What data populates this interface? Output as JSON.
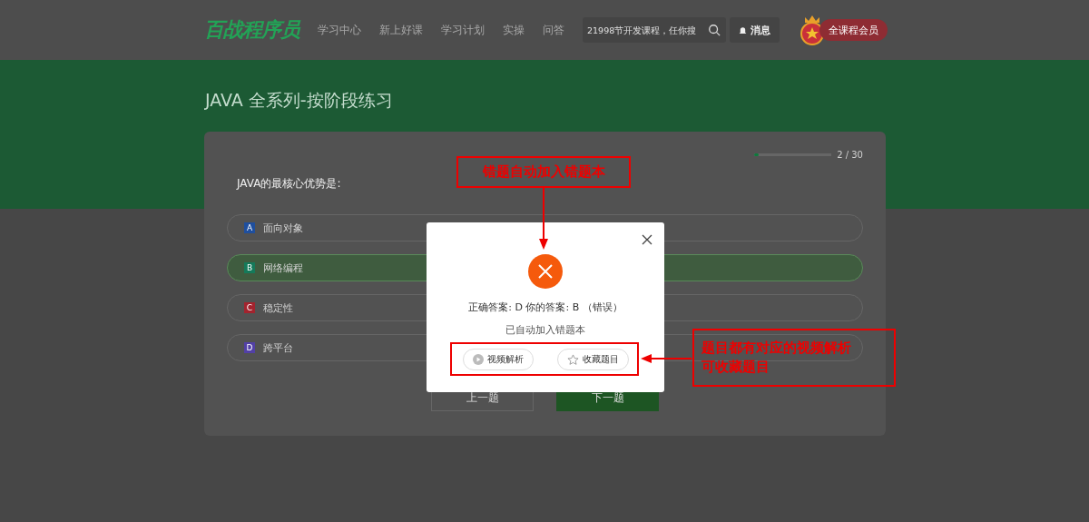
{
  "header": {
    "logo": "百战程序员",
    "nav": [
      "学习中心",
      "新上好课",
      "学习计划",
      "实操",
      "问答"
    ],
    "search": {
      "placeholder": "21998节开发课程，任你搜"
    },
    "messages": "消息",
    "member": "全课程会员"
  },
  "page_title": "JAVA 全系列-按阶段练习",
  "progress": {
    "level": 0.03,
    "reading": "2 / 30"
  },
  "question": "JAVA的最核心优势是:",
  "options": [
    {
      "letter": "A",
      "text": "面向对象",
      "color": "#1f4f9e",
      "selected": false
    },
    {
      "letter": "B",
      "text": "网络编程",
      "color": "#157a5a",
      "selected": true
    },
    {
      "letter": "C",
      "text": "稳定性",
      "color": "#a3232e",
      "selected": false
    },
    {
      "letter": "D",
      "text": "跨平台",
      "color": "#5240a6",
      "selected": false
    }
  ],
  "nav_buttons": {
    "prev": "上一题",
    "next": "下一题"
  },
  "dialog": {
    "result": "正确答案: D 你的答案: B （错误）",
    "note": "已自动加入错题本",
    "buttons": [
      {
        "kind": "video",
        "label": "视频解析"
      },
      {
        "kind": "star",
        "label": "收藏题目"
      }
    ]
  },
  "annotations": [
    {
      "kind": "top",
      "text": "错题自动加入错题本"
    },
    {
      "kind": "right",
      "lines": [
        "题目都有对应的视频解析",
        "可收藏题目"
      ]
    }
  ]
}
